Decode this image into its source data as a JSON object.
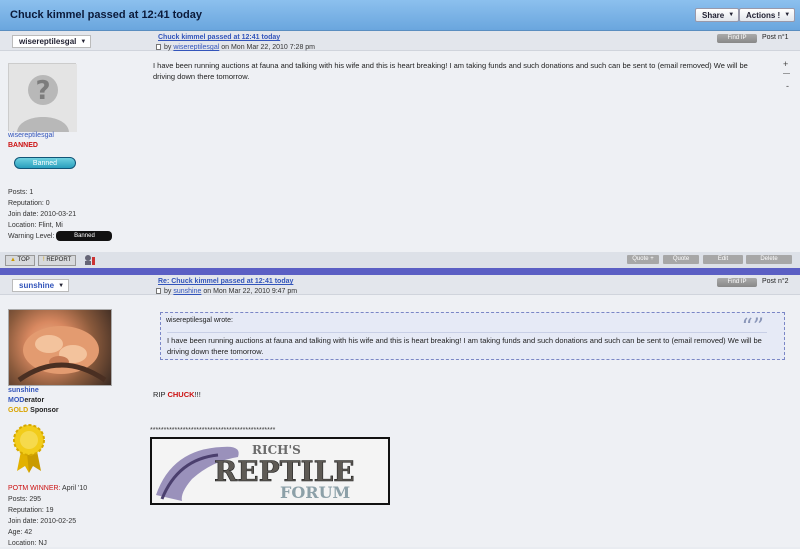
{
  "topbar": {
    "title": "Chuck kimmel passed at 12:41 today",
    "share_label": "Share",
    "actions_label": "Actions !"
  },
  "post1": {
    "username": "wisereptilesgal",
    "title": "Chuck kimmel passed at 12:41 today",
    "by_prefix": "by",
    "author": "wisereptilesgal",
    "date": "on Mon Mar 22, 2010 7:28 pm",
    "find_ip": "Find IP",
    "post_number": "Post n°1",
    "user_link": "wisereptilesgal",
    "rank": "BANNED",
    "rank_badge": "Banned",
    "stats": {
      "posts": "Posts: 1",
      "reputation": "Reputation: 0",
      "join_date": "Join date: 2010-03-21",
      "location": "Location: Flint, Mi",
      "warning_label": "Warning Level:",
      "warning_badge": "Banned"
    },
    "body": "I have been running auctions at fauna and talking with his wife and this is heart breaking! I am taking funds and such donations and such can be sent to (email removed) We will be driving down there tomorrow.",
    "side_plus": "+",
    "side_minus": "—",
    "side_dot": "-",
    "footer": {
      "top_label": "TOP",
      "report_label": "REPORT",
      "quote_plus_label": "Quote +",
      "quote_label": "Quote",
      "edit_label": "Edit",
      "delete_label": "Delete"
    }
  },
  "post2": {
    "username": "sunshine",
    "title": "Re: Chuck kimmel passed at 12:41 today",
    "by_prefix": "by",
    "author": "sunshine",
    "date": "on Mon Mar 22, 2010 9:47 pm",
    "find_ip": "Find IP",
    "post_number": "Post n°2",
    "user_link": "sunshine",
    "rank_line1_a": "MOD",
    "rank_line1_b": "erator",
    "rank_line2_a": "GOLD",
    "rank_line2_b": " Sponsor",
    "quote_author": "wisereptilesgal wrote:",
    "quote_text": "I have been running auctions at fauna and talking with his wife and this is heart breaking! I am taking funds and such donations and such can be sent to (email removed) We will be driving down there tomorrow.",
    "rip_prefix": "RIP ",
    "rip_name": "CHUCK",
    "rip_suffix": "!!!",
    "stars": "**********************************************",
    "banner_line1": "RICH'S",
    "banner_line2": "REPTILE",
    "banner_line3": "FORUM",
    "stats": {
      "potm_a": "POTM WINNER:",
      "potm_b": " April '10",
      "posts": "Posts: 295",
      "reputation": "Reputation: 19",
      "join_date": "Join date: 2010-02-25",
      "age": "Age: 42",
      "location": "Location: NJ"
    }
  },
  "colors": {
    "topbar": "#7fb4e6",
    "separator": "#5b5fc4",
    "link": "#3355bb",
    "banned": "#cc1111"
  }
}
